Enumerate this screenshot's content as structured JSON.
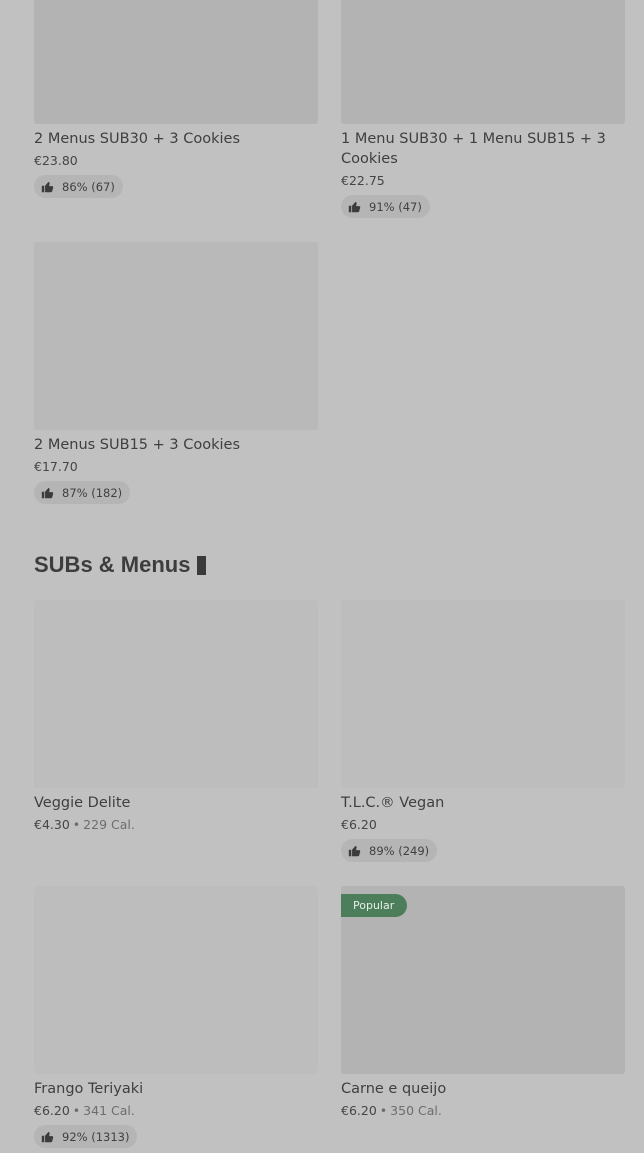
{
  "combos": [
    {
      "title": "2 Menus SUB30 + 3 Cookies",
      "price": "€23.80",
      "rating": "86% (67)"
    },
    {
      "title": "1 Menu SUB30 + 1 Menu SUB15 + 3 Cookies",
      "price": "€22.75",
      "rating": "91% (47)"
    },
    {
      "title": "2 Menus SUB15 + 3 Cookies",
      "price": "€17.70",
      "rating": "87% (182)"
    }
  ],
  "section": {
    "title": "SUBs & Menus"
  },
  "subs": [
    {
      "title": "Veggie Delite",
      "price": "€4.30",
      "separator": "•",
      "calories": "229 Cal."
    },
    {
      "title": "T.L.C.® Vegan",
      "price": "€6.20",
      "rating": "89% (249)"
    },
    {
      "title": "Frango Teriyaki",
      "price": "€6.20",
      "separator": "•",
      "calories": "341 Cal.",
      "rating": "92% (1313)"
    },
    {
      "title": "Carne e queijo",
      "price": "€6.20",
      "separator": "•",
      "calories": "350 Cal.",
      "badge": "Popular"
    }
  ],
  "icons": {
    "rating": "thumbs-up-icon"
  },
  "colors": {
    "background": "#c1c1c1",
    "image_placeholder": "#b3b3b3",
    "badge": "#4d7e5c"
  }
}
